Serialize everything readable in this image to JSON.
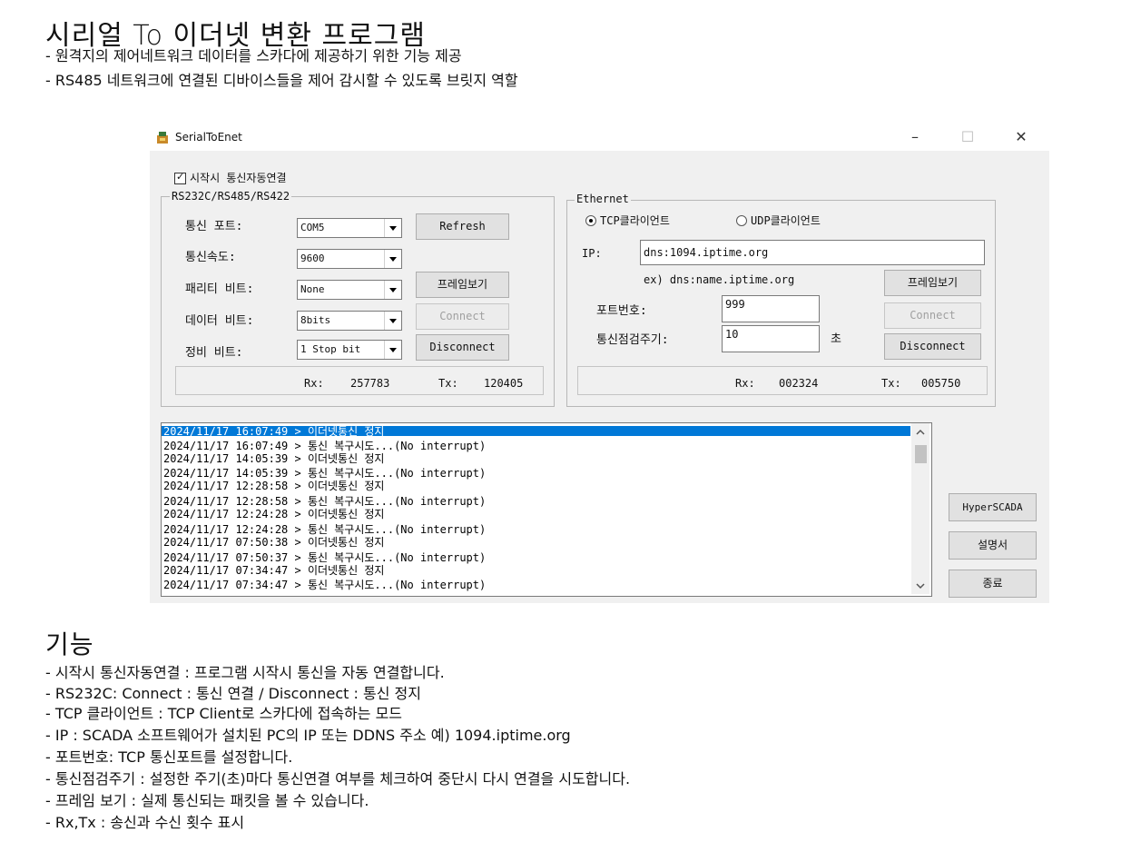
{
  "doc": {
    "title": "시리얼 To 이더넷 변환 프로그램",
    "desc": [
      "- 원격지의 제어네트워크 데이터를 스카다에 제공하기 위한 기능 제공",
      "- RS485 네트워크에 연결된 디바이스들을 제어 감시할 수 있도록 브릿지 역할"
    ],
    "features_title": "기능",
    "features": [
      "- 시작시 통신자동연결 :  프로그램 시작시 통신을 자동 연결합니다.",
      "- RS232C:  Connect : 통신 연결 / Disconnect : 통신 정지",
      "- TCP 클라이언트 : TCP Client로 스카다에 접속하는 모드",
      "- IP : SCADA 소프트웨어가 설치된 PC의 IP 또는 DDNS 주소  예) 1094.iptime.org",
      "- 포트번호: TCP 통신포트를 설정합니다.",
      "- 통신점검주기 :  설정한 주기(초)마다 통신연결 여부를 체크하여 중단시 다시 연결을 시도합니다.",
      "- 프레임 보기 : 실제 통신되는 패킷을 볼 수 있습니다.",
      "- Rx,Tx : 송신과 수신 횟수 표시"
    ]
  },
  "window": {
    "title": "SerialToEnet",
    "controls": {
      "minimize": "–",
      "maximize": "☐",
      "close": "✕"
    },
    "autoconnect_label": "시작시 통신자동연결",
    "serial": {
      "group_title": "RS232C/RS485/RS422",
      "port_label": "통신 포트:",
      "port_value": "COM5",
      "baud_label": "통신속도:",
      "baud_value": "9600",
      "parity_label": "패리티 비트:",
      "parity_value": "None",
      "data_label": "데이터 비트:",
      "data_value": "8bits",
      "stop_label": "정비 비트:",
      "stop_value": "1 Stop bit",
      "refresh_btn": "Refresh",
      "frame_btn": "프레임보기",
      "connect_btn": "Connect",
      "disconnect_btn": "Disconnect",
      "rx_label": "Rx:",
      "rx_value": "257783",
      "tx_label": "Tx:",
      "tx_value": "120405"
    },
    "ethernet": {
      "group_title": "Ethernet",
      "tcp_label": "TCP클라이언트",
      "udp_label": "UDP클라이언트",
      "ip_label": "IP:",
      "ip_value": "dns:1094.iptime.org",
      "example": "ex) dns:name.iptime.org",
      "frame_btn": "프레임보기",
      "port_label": "포트번호:",
      "port_value": "999",
      "interval_label": "통신점검주기:",
      "interval_value": "10",
      "interval_unit": "초",
      "connect_btn": "Connect",
      "disconnect_btn": "Disconnect",
      "rx_label": "Rx:",
      "rx_value": "002324",
      "tx_label": "Tx:",
      "tx_value": "005750"
    },
    "log": [
      "2024/11/17 16:07:49 > 이더넷통신 정지",
      "2024/11/17 16:07:49 > 통신 복구시도...(No interrupt)",
      "2024/11/17 14:05:39 > 이더넷통신 정지",
      "2024/11/17 14:05:39 > 통신 복구시도...(No interrupt)",
      "2024/11/17 12:28:58 > 이더넷통신 정지",
      "2024/11/17 12:28:58 > 통신 복구시도...(No interrupt)",
      "2024/11/17 12:24:28 > 이더넷통신 정지",
      "2024/11/17 12:24:28 > 통신 복구시도...(No interrupt)",
      "2024/11/17 07:50:38 > 이더넷통신 정지",
      "2024/11/17 07:50:37 > 통신 복구시도...(No interrupt)",
      "2024/11/17 07:34:47 > 이더넷통신 정지",
      "2024/11/17 07:34:47 > 통신 복구시도...(No interrupt)"
    ],
    "side_buttons": {
      "hyperscada": "HyperSCADA",
      "manual": "설명서",
      "exit": "종료"
    }
  }
}
